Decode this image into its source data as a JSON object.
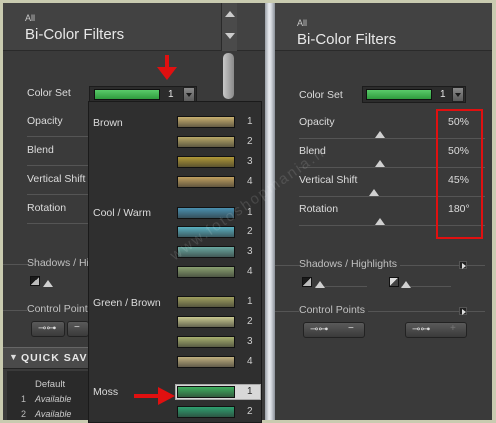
{
  "left": {
    "header": {
      "small": "All",
      "title": "Bi-Color Filters"
    },
    "controls": [
      {
        "label": "Color Set"
      },
      {
        "label": "Opacity"
      },
      {
        "label": "Blend"
      },
      {
        "label": "Vertical Shift"
      },
      {
        "label": "Rotation"
      }
    ],
    "color_set_value": "1",
    "sections": {
      "shadows": "Shadows / Hi",
      "control_points": "Control Points"
    },
    "quick": {
      "label": "QUICK SAV",
      "col_header": "Default",
      "rows": [
        {
          "num": "1",
          "text": "Available"
        },
        {
          "num": "2",
          "text": "Available"
        }
      ]
    }
  },
  "dropdown": {
    "groups": [
      {
        "name": "Brown",
        "items": [
          "1",
          "2",
          "3",
          "4"
        ],
        "colors": [
          "#c8b070",
          "#b8a868",
          "#b09838",
          "#c0a060"
        ]
      },
      {
        "name": "Cool / Warm",
        "items": [
          "1",
          "2",
          "3",
          "4"
        ],
        "colors": [
          "#4a90b0",
          "#5ab0c0",
          "#6aa8a0",
          "#8aa070"
        ]
      },
      {
        "name": "Green / Brown",
        "items": [
          "1",
          "2",
          "3",
          "4"
        ],
        "colors": [
          "#a0a060",
          "#c8c890",
          "#a8b070",
          "#c0b080"
        ]
      },
      {
        "name": "Moss",
        "items": [
          "1",
          "2"
        ],
        "colors": [
          "#40b060",
          "#30a070"
        ]
      }
    ]
  },
  "right": {
    "header": {
      "small": "All",
      "title": "Bi-Color Filters"
    },
    "color_set": {
      "label": "Color Set",
      "value": "1"
    },
    "sliders": [
      {
        "label": "Opacity",
        "value": "50%",
        "level": 0.5
      },
      {
        "label": "Blend",
        "value": "50%",
        "level": 0.5
      },
      {
        "label": "Vertical Shift",
        "value": "45%",
        "level": 0.45
      },
      {
        "label": "Rotation",
        "value": "180°",
        "level": 0.5
      }
    ],
    "sections": {
      "shadows": "Shadows / Highlights",
      "control_points": "Control Points"
    }
  },
  "watermark": "www.fotoshopmania.ir",
  "colors": {
    "annotation": "#e01010",
    "panel": "#3a3a3a",
    "frame": "#c9cbb0"
  }
}
